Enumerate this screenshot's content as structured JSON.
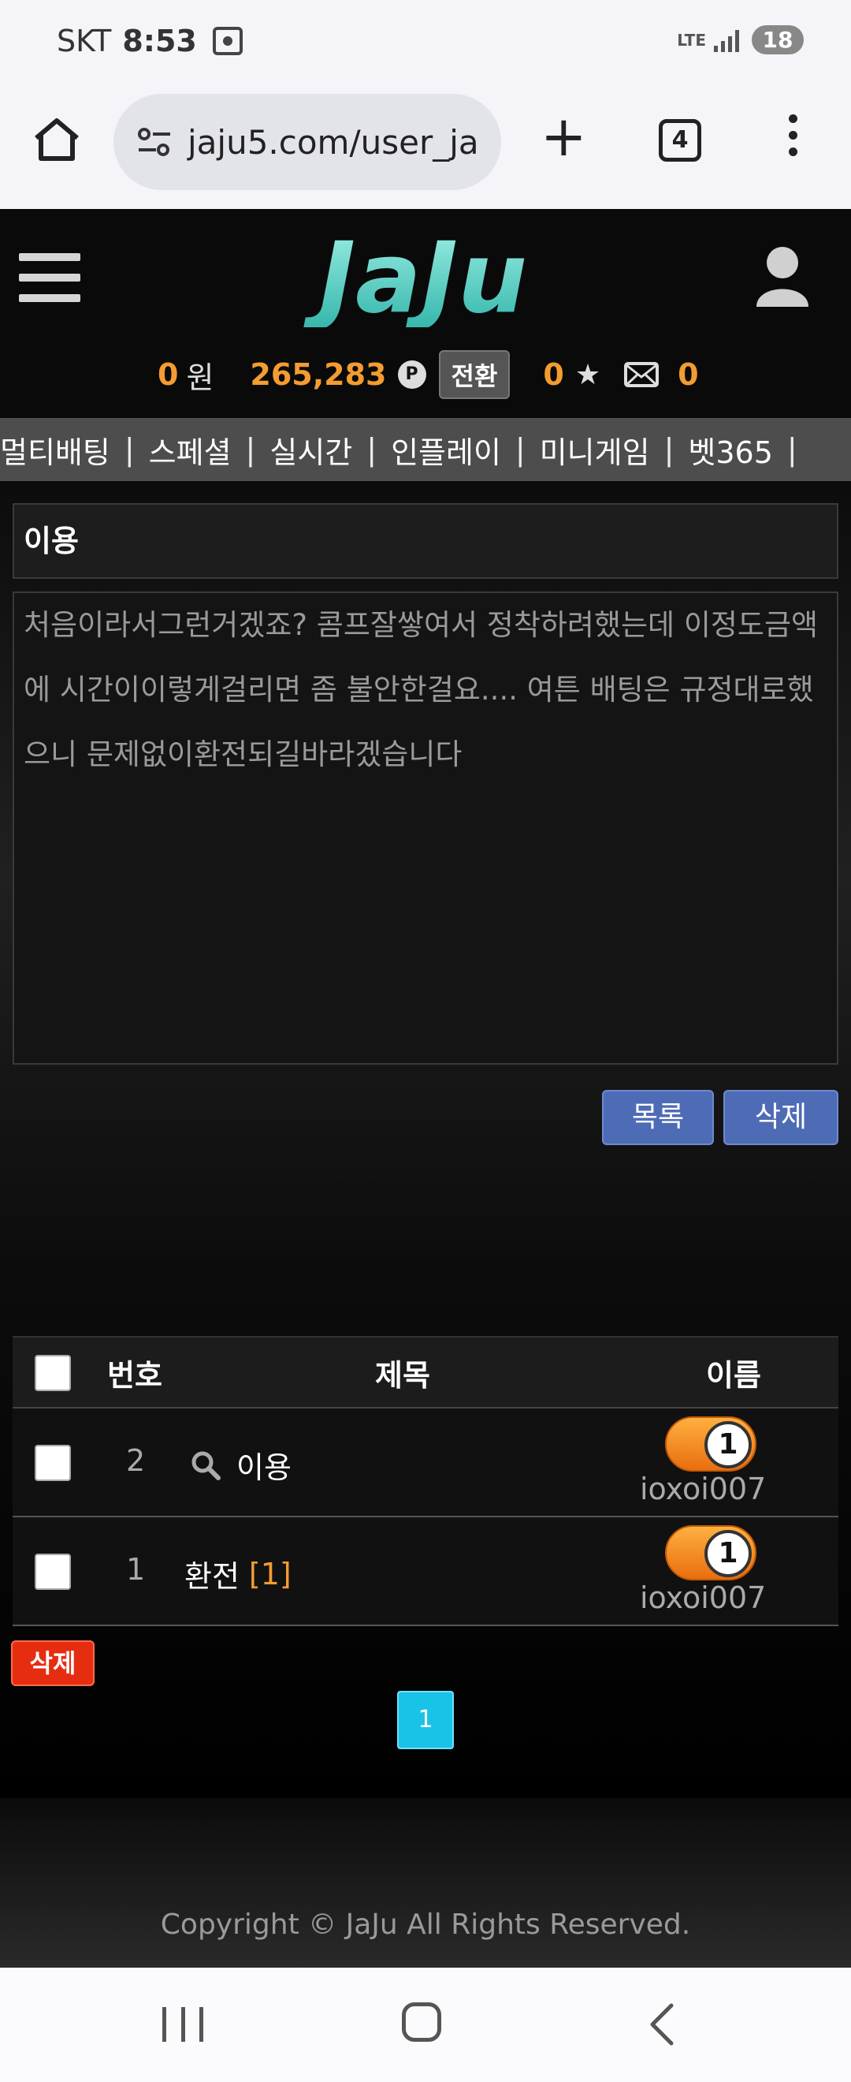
{
  "status_bar": {
    "carrier": "SKT",
    "time": "8:53",
    "network": "LTE",
    "battery": "18"
  },
  "browser": {
    "url": "jaju5.com/user_ja",
    "tab_count": "4"
  },
  "header": {
    "logo_text": "JaJu",
    "money_amount": "0",
    "money_unit": "원",
    "points": "265,283",
    "points_badge": "P",
    "switch_label": "전환",
    "star_count": "0",
    "mail_count": "0"
  },
  "nav": {
    "items": [
      "멀티배팅",
      "스페셜",
      "실시간",
      "인플레이",
      "미니게임",
      "벳365"
    ],
    "separator": "|"
  },
  "post": {
    "title": "이용",
    "body": "처음이라서그런거겠죠? 콤프잘쌓여서 정착하려했는데 이정도금액에 시간이이렇게걸리면 좀 불안한걸요.... 여튼 배팅은 규정대로했으니 문제없이환전되길바라겠습니다",
    "list_button": "목록",
    "delete_button": "삭제"
  },
  "table": {
    "headers": {
      "no": "번호",
      "title": "제목",
      "name": "이름"
    },
    "rows": [
      {
        "no": "2",
        "title": "이용",
        "comment_count": "",
        "level": "1",
        "name": "ioxoi007",
        "icon": "search-icon"
      },
      {
        "no": "1",
        "title": "환전",
        "comment_count": "[1]",
        "level": "1",
        "name": "ioxoi007"
      }
    ],
    "delete_button": "삭제",
    "current_page": "1"
  },
  "footer": {
    "copyright": "Copyright © JaJu All Rights Reserved."
  },
  "colors": {
    "accent_orange": "#f39c31",
    "nav_bg": "#4d4d4d",
    "button_blue": "#4e6cb5",
    "button_red": "#e62d10",
    "page_cyan": "#19c3e8",
    "logo_teal": "#4fd1c5"
  }
}
